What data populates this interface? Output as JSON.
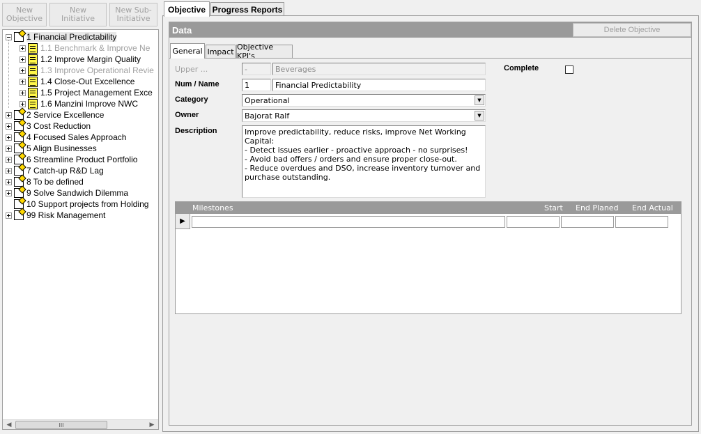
{
  "toolbar": {
    "new_objective": "New Objective",
    "new_initiative": "New Initiative",
    "new_sub_initiative": "New Sub-Initiative"
  },
  "tree": {
    "items": [
      {
        "label": "1 Financial Predictability",
        "level": 0,
        "expanded": true,
        "type": "objective",
        "dim": false,
        "selected": true
      },
      {
        "label": "1.1 Benchmark & Improve Ne",
        "level": 1,
        "type": "initiative",
        "dim": true
      },
      {
        "label": "1.2 Improve Margin Quality",
        "level": 1,
        "type": "initiative",
        "dim": false
      },
      {
        "label": "1.3 Improve Operational Revie",
        "level": 1,
        "type": "initiative",
        "dim": true
      },
      {
        "label": "1.4 Close-Out Excellence",
        "level": 1,
        "type": "initiative",
        "dim": false
      },
      {
        "label": "1.5 Project Management Exce",
        "level": 1,
        "type": "initiative",
        "dim": false
      },
      {
        "label": "1.6 Manzini Improve NWC",
        "level": 1,
        "type": "initiative",
        "dim": false
      },
      {
        "label": "2 Service Excellence",
        "level": 0,
        "type": "objective",
        "dim": false
      },
      {
        "label": "3 Cost Reduction",
        "level": 0,
        "type": "objective",
        "dim": false
      },
      {
        "label": "4 Focused Sales Approach",
        "level": 0,
        "type": "objective",
        "dim": false
      },
      {
        "label": "5 Align Businesses",
        "level": 0,
        "type": "objective",
        "dim": false
      },
      {
        "label": "6 Streamline Product Portfolio",
        "level": 0,
        "type": "objective",
        "dim": false
      },
      {
        "label": "7 Catch-up R&D Lag",
        "level": 0,
        "type": "objective",
        "dim": false
      },
      {
        "label": "8 To be defined",
        "level": 0,
        "type": "objective",
        "dim": false
      },
      {
        "label": "9 Solve Sandwich Dilemma",
        "level": 0,
        "type": "objective",
        "dim": false
      },
      {
        "label": "10 Support projects from Holding",
        "level": 0,
        "type": "objective",
        "dim": false,
        "no_expander": true
      },
      {
        "label": "99 Risk Management",
        "level": 0,
        "type": "objective",
        "dim": false
      }
    ],
    "scroll_thumb_glyph": "III"
  },
  "tabs": {
    "objective": "Objective",
    "progress_reports": "Progress Reports"
  },
  "data_panel": {
    "title": "Data",
    "delete_button": "Delete Objective",
    "inner_tabs": {
      "general": "General",
      "impact": "Impact",
      "kpis": "Objective KPI's"
    }
  },
  "form": {
    "upper_label": "Upper ...",
    "upper_code": "-",
    "upper_name": "Beverages",
    "num_name_label": "Num / Name",
    "num": "1",
    "name": "Financial Predictability",
    "category_label": "Category",
    "category": "Operational",
    "owner_label": "Owner",
    "owner": "Bajorat Ralf",
    "description_label": "Description",
    "description": "Improve predictability, reduce risks, improve Net Working Capital:\n- Detect issues earlier - proactive approach - no surprises!\n- Avoid bad offers / orders and ensure proper close-out.\n- Reduce overdues and DSO, increase inventory turnover and\npurchase outstanding.",
    "complete_label": "Complete",
    "complete_checked": false
  },
  "milestones": {
    "columns": {
      "milestones": "Milestones",
      "start": "Start",
      "end_planned": "End Planed",
      "end_actual": "End Actual"
    },
    "row_marker": "▶",
    "rows": [
      {
        "milestone": "",
        "start": "",
        "end_planned": "",
        "end_actual": ""
      }
    ]
  },
  "colors": {
    "header_gray": "#9a9a9a",
    "disabled_text": "#a0a0a0",
    "initiative_icon": "#fff64a"
  }
}
